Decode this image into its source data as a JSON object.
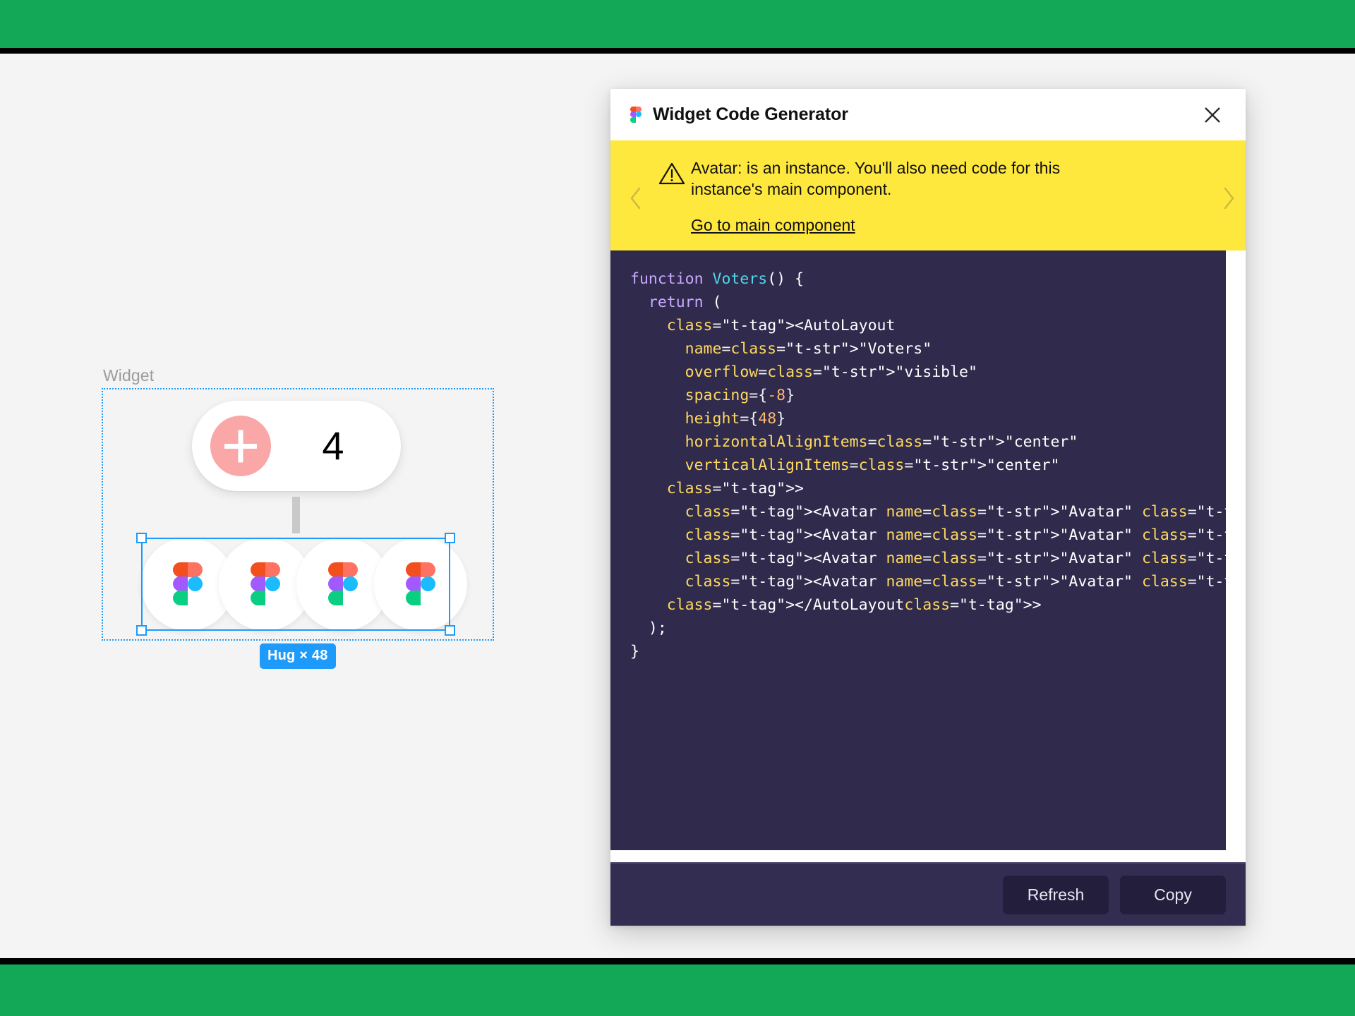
{
  "canvas": {
    "widget_label": "Widget",
    "vote_count": "4",
    "plus_icon": "plus-icon",
    "avatar_count": 4,
    "avatar_icon": "figma-logo-icon",
    "size_badge": "Hug × 48"
  },
  "panel": {
    "title": "Widget Code Generator",
    "logo_icon": "figma-logo-icon",
    "close_icon": "close-icon"
  },
  "warning": {
    "prev_icon": "chevron-left-icon",
    "next_icon": "chevron-right-icon",
    "alert_icon": "warning-triangle-icon",
    "message": "Avatar: is an instance. You'll also need code for this instance's main component.",
    "link_label": "Go to main component"
  },
  "code": {
    "language": "jsx",
    "lines": [
      "function Voters() {",
      "  return (",
      "    <AutoLayout",
      "      name=\"Voters\"",
      "      overflow=\"visible\"",
      "      spacing={-8}",
      "      height={48}",
      "      horizontalAlignItems=\"center\"",
      "      verticalAlignItems=\"center\"",
      "    >",
      "      <Avatar name=\"Avatar\" />",
      "      <Avatar name=\"Avatar\" />",
      "      <Avatar name=\"Avatar\" />",
      "      <Avatar name=\"Avatar\" />",
      "    </AutoLayout>",
      "  );",
      "}"
    ]
  },
  "footer": {
    "refresh_label": "Refresh",
    "copy_label": "Copy"
  },
  "colors": {
    "screen_band": "#12a857",
    "canvas_bg": "#f4f4f4",
    "selection_blue": "#1e9bfa",
    "warning_yellow": "#ffe83d",
    "code_bg": "#302b4d",
    "footer_bg": "#332e51",
    "accent_pink": "#f9a7a7"
  }
}
